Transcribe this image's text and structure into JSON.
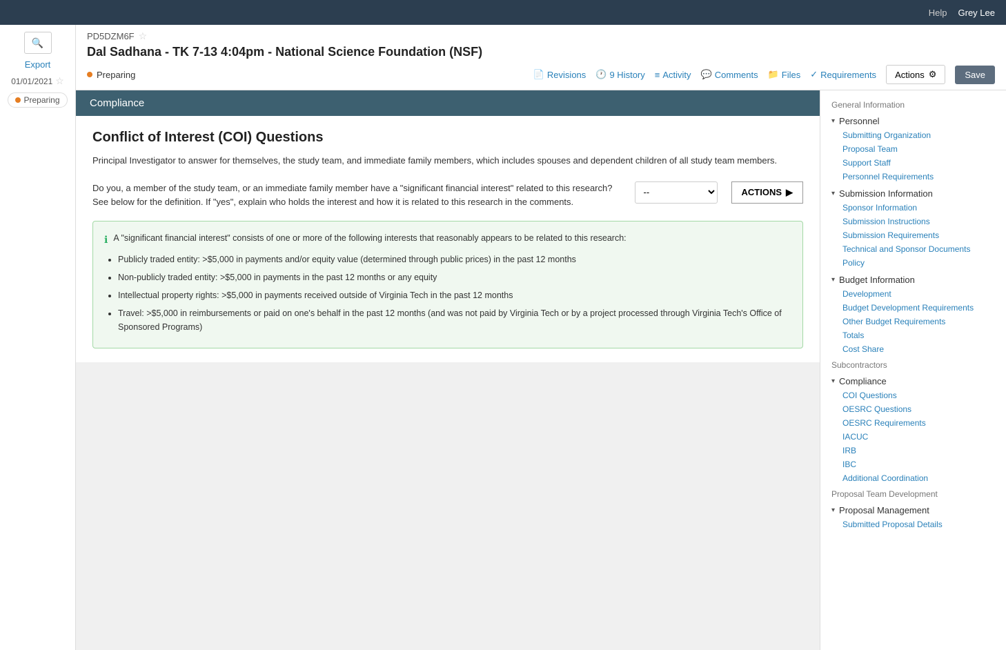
{
  "topbar": {
    "help_label": "Help",
    "user_label": "Grey Lee"
  },
  "left_sidebar": {
    "search_icon": "🔍",
    "export_label": "Export",
    "date": "01/01/2021",
    "star_icon": "☆",
    "preparing_label": "Preparing"
  },
  "header": {
    "proposal_id": "PD5DZM6F",
    "star_icon": "☆",
    "proposal_title": "Dal Sadhana - TK 7-13 4:04pm - National Science Foundation (NSF)",
    "status_dot_color": "#e67e22",
    "status_label": "Preparing",
    "nav": {
      "revisions_icon": "📄",
      "revisions_label": "Revisions",
      "history_icon": "🕐",
      "history_label": "9 History",
      "activity_icon": "≡",
      "activity_label": "Activity",
      "comments_icon": "💬",
      "comments_label": "Comments",
      "files_icon": "📁",
      "files_label": "Files",
      "requirements_icon": "✓",
      "requirements_label": "Requirements"
    },
    "actions_label": "Actions",
    "actions_gear": "⚙",
    "save_label": "Save"
  },
  "right_nav": {
    "sections": [
      {
        "type": "label",
        "label": "General Information"
      },
      {
        "type": "group",
        "label": "Personnel",
        "expanded": true,
        "items": [
          "Submitting Organization",
          "Proposal Team",
          "Support Staff",
          "Personnel Requirements"
        ]
      },
      {
        "type": "group",
        "label": "Submission Information",
        "expanded": true,
        "items": [
          "Sponsor Information",
          "Submission Instructions",
          "Submission Requirements",
          "Technical and Sponsor Documents",
          "Policy"
        ]
      },
      {
        "type": "group",
        "label": "Budget Information",
        "expanded": true,
        "items": [
          "Development",
          "Budget Development Requirements",
          "Other Budget Requirements",
          "Totals",
          "Cost Share"
        ]
      },
      {
        "type": "label",
        "label": "Subcontractors"
      },
      {
        "type": "group",
        "label": "Compliance",
        "expanded": true,
        "items": [
          "COI Questions",
          "OESRC Questions",
          "OESRC Requirements",
          "IACUC",
          "IRB",
          "IBC",
          "Additional Coordination"
        ]
      },
      {
        "type": "label",
        "label": "Proposal Team Development"
      },
      {
        "type": "group",
        "label": "Proposal Management",
        "expanded": true,
        "items": [
          "Submitted Proposal Details"
        ]
      }
    ]
  },
  "compliance": {
    "header": "Compliance",
    "coi_title": "Conflict of Interest (COI) Questions",
    "coi_description": "Principal Investigator to answer for themselves, the study team, and immediate family members, which includes spouses and dependent children of all study team members.",
    "question_text": "Do you, a member of the study team, or an immediate family member have a \"significant financial interest\" related to this research? See below for the definition. If \"yes\", explain who holds the interest and how it is related to this research in the comments.",
    "select_placeholder": "--",
    "actions_label": "ACTIONS",
    "info_header": "A \"significant financial interest\" consists of one or more of the following interests that reasonably appears to be related to this research:",
    "info_items": [
      "Publicly traded entity: >$5,000 in payments and/or equity value (determined through public prices) in the past 12 months",
      "Non-publicly traded entity: >$5,000 in payments in the past 12 months or any equity",
      "Intellectual property rights: >$5,000 in payments received outside of Virginia Tech in the past 12 months",
      "Travel: >$5,000 in reimbursements or paid on one's behalf in the past 12 months (and was not paid by Virginia Tech or by a project processed through Virginia Tech's Office of Sponsored Programs)"
    ]
  }
}
